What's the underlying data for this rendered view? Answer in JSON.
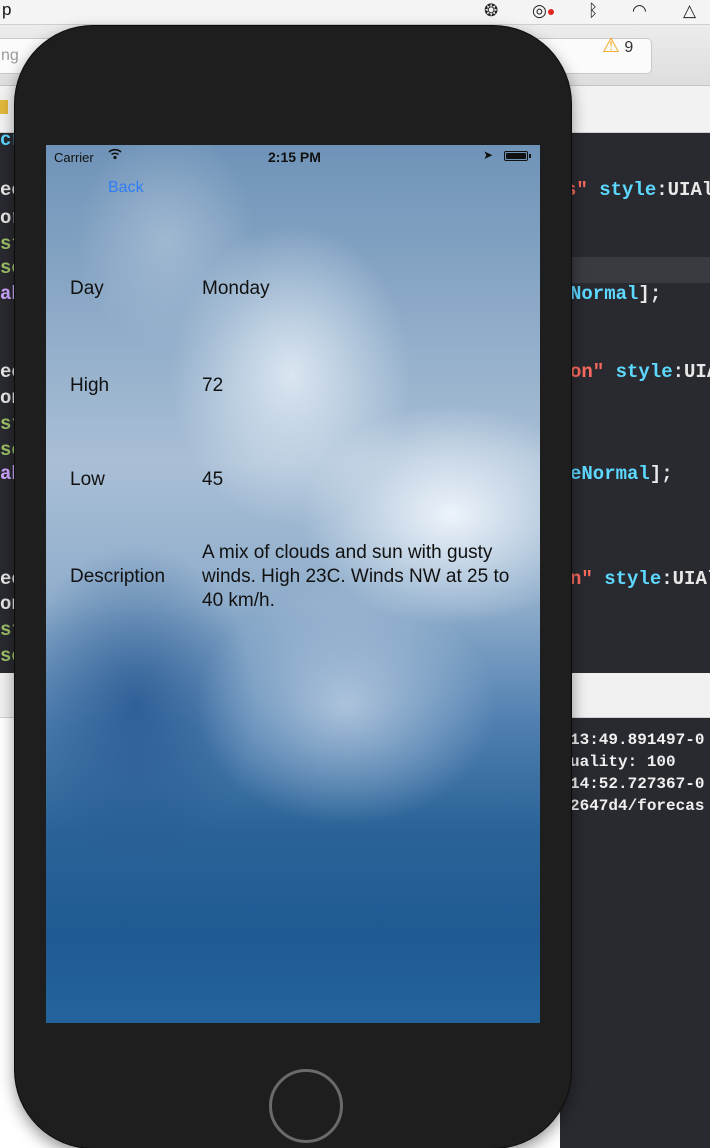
{
  "mac_menubar": {
    "app_fragment": "p"
  },
  "xcode": {
    "activity_text": "ng",
    "warning_count": "9",
    "code_lines": [
      {
        "tokens": [
          {
            "t": "s\" ",
            "c": "str"
          },
          {
            "t": "style",
            "c": "kw"
          },
          {
            "t": ":UIAle",
            "c": "plain"
          }
        ]
      },
      {
        "tokens": [
          {
            "t": "Normal",
            "c": "kw"
          },
          {
            "t": "];",
            "c": "plain"
          }
        ]
      },
      {
        "tokens": [
          {
            "t": "on\" ",
            "c": "str"
          },
          {
            "t": "style",
            "c": "kw"
          },
          {
            "t": ":UIA",
            "c": "plain"
          }
        ]
      },
      {
        "tokens": [
          {
            "t": "eNormal",
            "c": "kw"
          },
          {
            "t": "];",
            "c": "plain"
          }
        ]
      },
      {
        "tokens": [
          {
            "t": "n\" ",
            "c": "str"
          },
          {
            "t": "style",
            "c": "kw"
          },
          {
            "t": ":UIAle",
            "c": "plain"
          }
        ]
      }
    ],
    "left_fragments": [
      "cr",
      "ee",
      "or",
      "st",
      "se",
      "ab",
      "ee",
      "on",
      "st",
      "se",
      "ab",
      "ee",
      "on",
      "st",
      "se"
    ],
    "console_lines": [
      "13:49.891497-0",
      "uality: 100",
      "14:52.727367-0",
      "2647d4/forecas"
    ]
  },
  "status_bar": {
    "carrier": "Carrier",
    "time": "2:15 PM"
  },
  "nav": {
    "back_label": "Back"
  },
  "forecast": {
    "day_label": "Day",
    "day_value": "Monday",
    "high_label": "High",
    "high_value": "72",
    "low_label": "Low",
    "low_value": "45",
    "description_label": "Description",
    "description_value": "A mix of clouds and sun with gusty winds. High 23C. Winds NW at 25 to 40 km/h."
  },
  "icons": [
    "wifi-icon",
    "location-arrow-icon",
    "battery-icon",
    "warning-icon",
    "folder-icon",
    "home-button"
  ],
  "colors": {
    "back_link": "#2e7cf6",
    "editor_bg": "#292a30",
    "warning": "#f3a51d"
  }
}
